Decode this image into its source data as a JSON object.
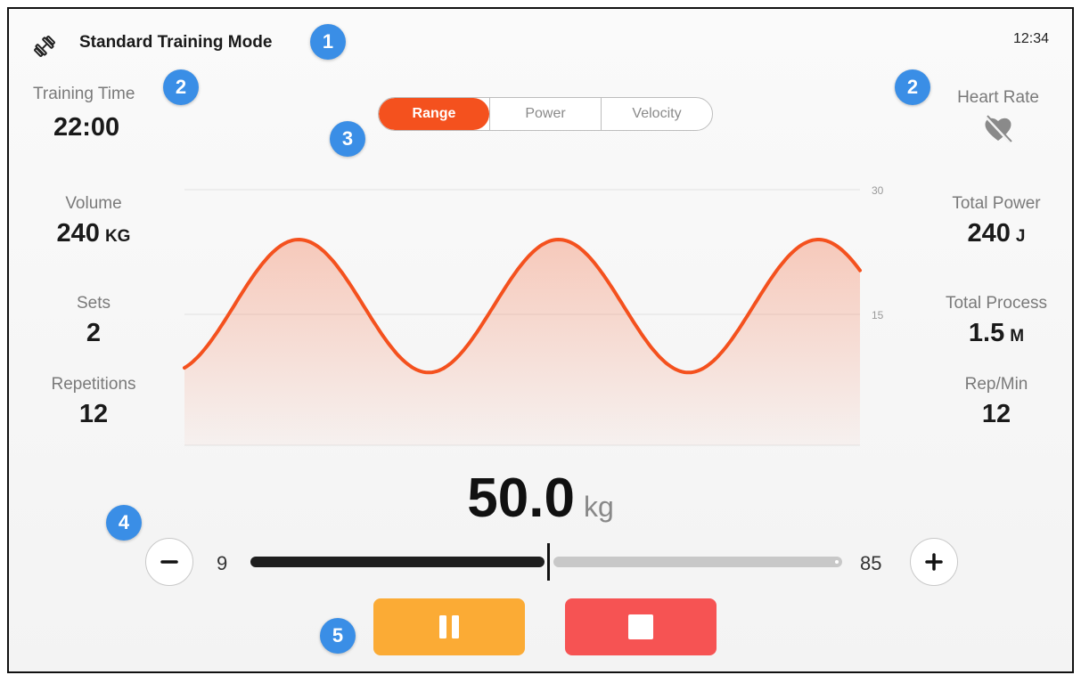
{
  "header": {
    "title": "Standard Training Mode",
    "time": "12:34",
    "icon": "dumbbell-icon"
  },
  "badges": {
    "b1": "1",
    "b2a": "2",
    "b2b": "2",
    "b3": "3",
    "b4": "4",
    "b5": "5"
  },
  "stats_left": {
    "training_time_label": "Training Time",
    "training_time_value": "22:00",
    "volume_label": "Volume",
    "volume_value": "240",
    "volume_unit": "KG",
    "sets_label": "Sets",
    "sets_value": "2",
    "reps_label": "Repetitions",
    "reps_value": "12"
  },
  "stats_right": {
    "heart_rate_label": "Heart Rate",
    "heart_rate_icon": "heart-disconnected-icon",
    "total_power_label": "Total Power",
    "total_power_value": "240",
    "total_power_unit": "J",
    "total_process_label": "Total Process",
    "total_process_value": "1.5",
    "total_process_unit": "M",
    "rep_min_label": "Rep/Min",
    "rep_min_value": "12"
  },
  "tabs": {
    "items": [
      "Range",
      "Power",
      "Velocity"
    ],
    "active": "Range"
  },
  "chart_data": {
    "type": "area",
    "y_ticks": [
      "30",
      "15"
    ],
    "ylim": [
      0,
      30
    ],
    "y_axis_side": "right",
    "grid": true,
    "wave": {
      "min": 8,
      "max": 24,
      "cycles": 2.6,
      "start_phase": "low"
    },
    "color": "#f4511e"
  },
  "weight": {
    "value": "50.0",
    "unit": "kg",
    "min": "9",
    "max": "85",
    "fraction": 0.5
  },
  "controls": {
    "pause_icon": "pause-icon",
    "stop_icon": "stop-icon",
    "pause_color": "#fbab35",
    "stop_color": "#f65353"
  }
}
